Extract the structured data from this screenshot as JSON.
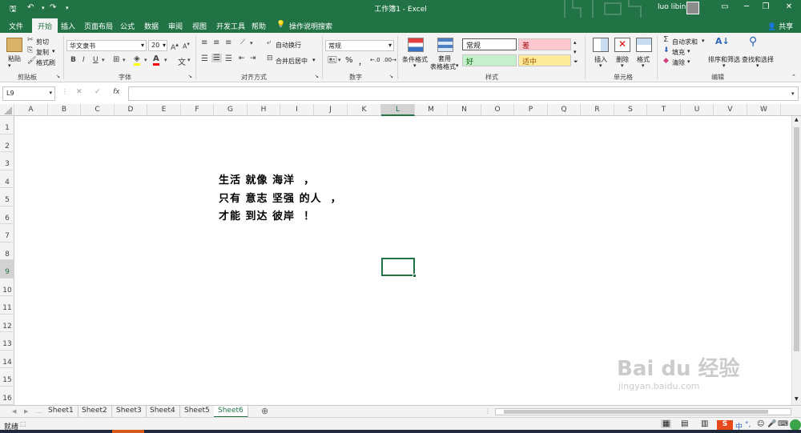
{
  "window": {
    "title": "工作簿1  -  Excel",
    "user": "luo libin"
  },
  "colors": {
    "brand": "#217346",
    "selected_border": "#217346",
    "bad_bg": "#ffc7ce",
    "bad_text": "#9c0006",
    "good_bg": "#c6efce",
    "good_text": "#006100",
    "neutral_bg": "#ffeb9c",
    "neutral_text": "#9c5700"
  },
  "menu": {
    "tabs": [
      "文件",
      "开始",
      "插入",
      "页面布局",
      "公式",
      "数据",
      "审阅",
      "视图",
      "开发工具",
      "帮助"
    ],
    "search": "操作说明搜索",
    "share": "共享"
  },
  "ribbon": {
    "clipboard": {
      "paste": "粘贴",
      "cut": "剪切",
      "copy": "复制",
      "format_painter": "格式刷",
      "label": "剪贴板"
    },
    "font": {
      "name": "华文隶书",
      "size": "20",
      "label": "字体"
    },
    "alignment": {
      "wrap": "自动换行",
      "merge": "合并后居中",
      "label": "对齐方式"
    },
    "number": {
      "format": "常规",
      "percent": "%",
      "comma": "，",
      "label": "数字"
    },
    "styles": {
      "conditional": "条件格式",
      "table_fmt_1": "套用",
      "table_fmt_2": "表格格式",
      "normal": "常规",
      "bad": "差",
      "good": "好",
      "neutral": "适中",
      "label": "样式"
    },
    "cells": {
      "insert": "插入",
      "delete": "删除",
      "format": "格式",
      "label": "单元格"
    },
    "editing": {
      "autosum": "自动求和",
      "fill": "填充",
      "clear": "清除",
      "sort": "排序和筛选",
      "find": "查找和选择",
      "label": "编辑"
    }
  },
  "formula_bar": {
    "name_box": "L9",
    "fx": "fx",
    "value": ""
  },
  "grid": {
    "columns": [
      "A",
      "B",
      "C",
      "D",
      "E",
      "F",
      "G",
      "H",
      "I",
      "J",
      "K",
      "L",
      "M",
      "N",
      "O",
      "P",
      "Q",
      "R",
      "S",
      "T",
      "U",
      "V",
      "W"
    ],
    "rows": [
      "1",
      "2",
      "3",
      "4",
      "5",
      "6",
      "7",
      "8",
      "9",
      "10",
      "11",
      "12",
      "13",
      "14",
      "15",
      "16"
    ],
    "selected_column": "L",
    "selected_row": "9",
    "poem_lines": [
      "生活 就像 海洋  ，",
      "只有 意志 坚强 的人  ，",
      "才能 到达 彼岸  ！"
    ]
  },
  "sheets": {
    "tabs": [
      "Sheet1",
      "Sheet2",
      "Sheet3",
      "Sheet4",
      "Sheet5",
      "Sheet6"
    ],
    "active": "Sheet6"
  },
  "status": {
    "text": "就绪",
    "ime": "中"
  },
  "watermark": {
    "brand": "Bai du 经验",
    "url": "jingyan.baidu.com"
  }
}
